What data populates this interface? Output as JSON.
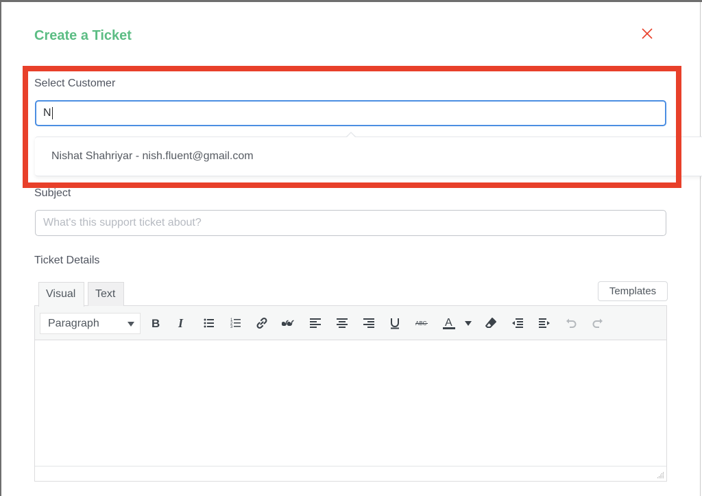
{
  "modal": {
    "title": "Create a Ticket",
    "close_icon": "close-icon",
    "accent_color": "#5cbd84",
    "close_color": "#e8402a"
  },
  "customer": {
    "label": "Select Customer",
    "value": "N",
    "suggestions": [
      {
        "label": "Nishat Shahriyar - nish.fluent@gmail.com"
      }
    ]
  },
  "highlight": {
    "color": "#e8402a"
  },
  "subject": {
    "label": "Subject",
    "value": "",
    "placeholder": "What's this support ticket about?"
  },
  "details": {
    "label": "Ticket Details",
    "tabs": [
      {
        "label": "Visual",
        "active": true
      },
      {
        "label": "Text",
        "active": false
      }
    ],
    "templates_label": "Templates",
    "format_select": {
      "value": "Paragraph"
    },
    "toolbar": [
      {
        "name": "bold",
        "icon": "bold-icon"
      },
      {
        "name": "italic",
        "icon": "italic-icon"
      },
      {
        "name": "bulleted-list",
        "icon": "bullet-list-icon"
      },
      {
        "name": "numbered-list",
        "icon": "numbered-list-icon"
      },
      {
        "name": "link",
        "icon": "link-icon"
      },
      {
        "name": "blockquote",
        "icon": "quote-icon"
      },
      {
        "name": "align-left",
        "icon": "align-left-icon"
      },
      {
        "name": "align-center",
        "icon": "align-center-icon"
      },
      {
        "name": "align-right",
        "icon": "align-right-icon"
      },
      {
        "name": "underline",
        "icon": "underline-icon"
      },
      {
        "name": "strikethrough",
        "icon": "strikethrough-icon"
      },
      {
        "name": "text-color",
        "icon": "text-color-icon"
      },
      {
        "name": "text-color-dropdown",
        "icon": "caret-down-icon"
      },
      {
        "name": "clear-formatting",
        "icon": "eraser-icon"
      },
      {
        "name": "outdent",
        "icon": "outdent-icon"
      },
      {
        "name": "indent",
        "icon": "indent-icon"
      },
      {
        "name": "undo",
        "icon": "undo-icon",
        "disabled": true
      },
      {
        "name": "redo",
        "icon": "redo-icon",
        "disabled": true
      }
    ],
    "body_text": ""
  }
}
